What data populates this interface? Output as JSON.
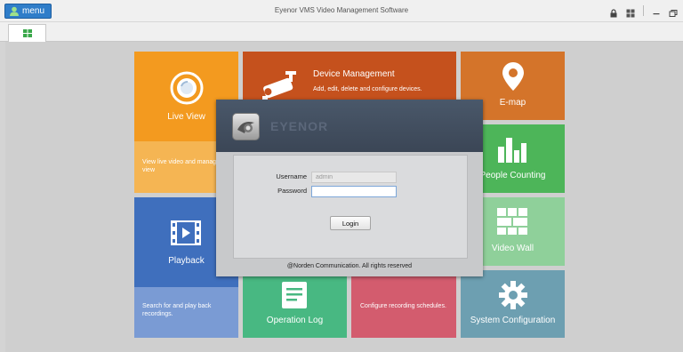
{
  "app": {
    "title": "Eyenor VMS Video Management Software",
    "menu_label": "menu"
  },
  "tiles": {
    "live_view": {
      "label": "Live View",
      "desc": "View live video and manag view"
    },
    "device_management": {
      "label": "Device Management",
      "desc": "Add, edit, delete and configure devices."
    },
    "emap": {
      "label": "E-map"
    },
    "people_counting": {
      "label": "People Counting"
    },
    "playback": {
      "label": "Playback",
      "desc": "Search for and play back recordings."
    },
    "video_wall": {
      "label": "Video Wall"
    },
    "operation_log": {
      "label": "Operation Log"
    },
    "recording_schedule": {
      "desc": "Configure recording schedules."
    },
    "system_configuration": {
      "label": "System Configuration"
    }
  },
  "login": {
    "brand": "EYENOR",
    "username_label": "Username",
    "username_value": "admin",
    "password_label": "Password",
    "password_value": "",
    "login_button": "Login",
    "copyright": "@Norden Communication. All rights reserved"
  },
  "colors": {
    "live_view": "#f39a1f",
    "live_view_desc": "#f5b553",
    "device_management": "#c5511d",
    "emap": "#d4742a",
    "people_counting": "#4db559",
    "playback": "#3f6fbd",
    "playback_desc": "#7a9bd4",
    "video_wall": "#8fd09a",
    "operation_log": "#48b882",
    "recording_schedule": "#d35c6e",
    "system_configuration": "#6d9fb1",
    "menu_button": "#2f7dc9",
    "dialog_header": "#444f5f"
  }
}
